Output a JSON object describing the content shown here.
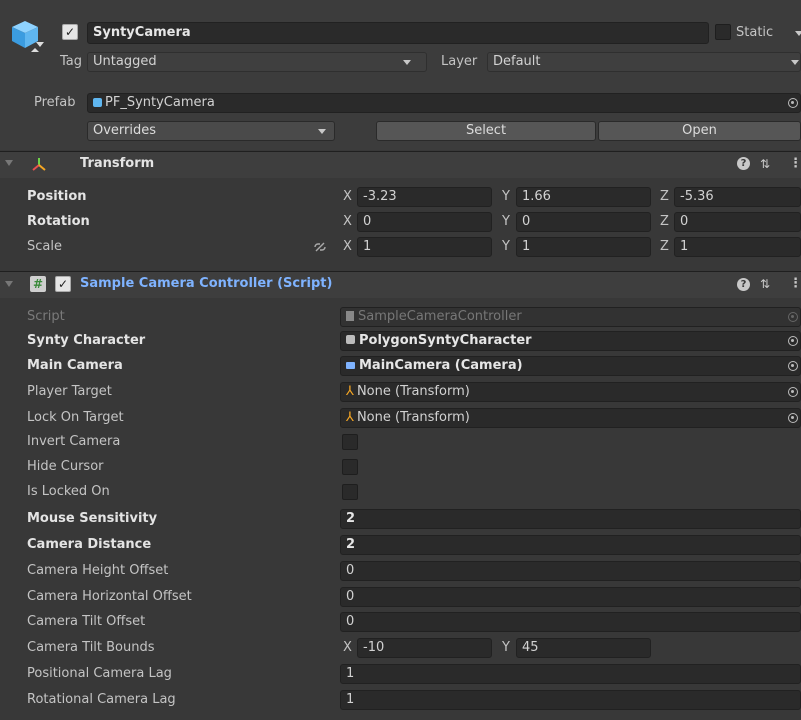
{
  "gameobject": {
    "name": "SyntyCamera",
    "static_label": "Static",
    "tag_label": "Tag",
    "tag_value": "Untagged",
    "layer_label": "Layer",
    "layer_value": "Default",
    "prefab_label": "Prefab",
    "prefab_value": "PF_SyntyCamera",
    "overrides_label": "Overrides",
    "select_label": "Select",
    "open_label": "Open"
  },
  "transform": {
    "title": "Transform",
    "rows": [
      {
        "label": "Position",
        "x": "-3.23",
        "y": "1.66",
        "z": "-5.36"
      },
      {
        "label": "Rotation",
        "x": "0",
        "y": "0",
        "z": "0"
      },
      {
        "label": "Scale",
        "x": "1",
        "y": "1",
        "z": "1"
      }
    ],
    "axis_x": "X",
    "axis_y": "Y",
    "axis_z": "Z"
  },
  "script_component": {
    "title": "Sample Camera Controller (Script)",
    "script_label": "Script",
    "script_value": "SampleCameraController",
    "fields": {
      "synty_character": {
        "label": "Synty Character",
        "value": "PolygonSyntyCharacter"
      },
      "main_camera": {
        "label": "Main Camera",
        "value": "MainCamera (Camera)"
      },
      "player_target": {
        "label": "Player Target",
        "value": "None (Transform)"
      },
      "lock_on_target": {
        "label": "Lock On Target",
        "value": "None (Transform)"
      },
      "invert_camera": {
        "label": "Invert Camera",
        "checked": false
      },
      "hide_cursor": {
        "label": "Hide Cursor",
        "checked": false
      },
      "is_locked_on": {
        "label": "Is Locked On",
        "checked": false
      },
      "mouse_sensitivity": {
        "label": "Mouse Sensitivity",
        "value": "2"
      },
      "camera_distance": {
        "label": "Camera Distance",
        "value": "2"
      },
      "camera_height_offset": {
        "label": "Camera Height Offset",
        "value": "0"
      },
      "camera_horizontal_offset": {
        "label": "Camera Horizontal Offset",
        "value": "0"
      },
      "camera_tilt_offset": {
        "label": "Camera Tilt Offset",
        "value": "0"
      },
      "camera_tilt_bounds": {
        "label": "Camera Tilt Bounds",
        "x": "-10",
        "y": "45"
      },
      "positional_camera_lag": {
        "label": "Positional Camera Lag",
        "value": "1"
      },
      "rotational_camera_lag": {
        "label": "Rotational Camera Lag",
        "value": "1"
      }
    }
  },
  "icons": {
    "gameobject": "cube-icon",
    "transform": "transform-axes-icon",
    "script": "script-hash-icon",
    "help": "help-icon",
    "presets": "presets-icon",
    "menu": "kebab-menu-icon",
    "link": "constrain-proportions-icon",
    "object_picker": "object-picker-icon"
  },
  "colors": {
    "background": "#383838",
    "field": "#2a2a2a",
    "accent_blue": "#7fb3ff",
    "header": "#3e3e3e"
  }
}
